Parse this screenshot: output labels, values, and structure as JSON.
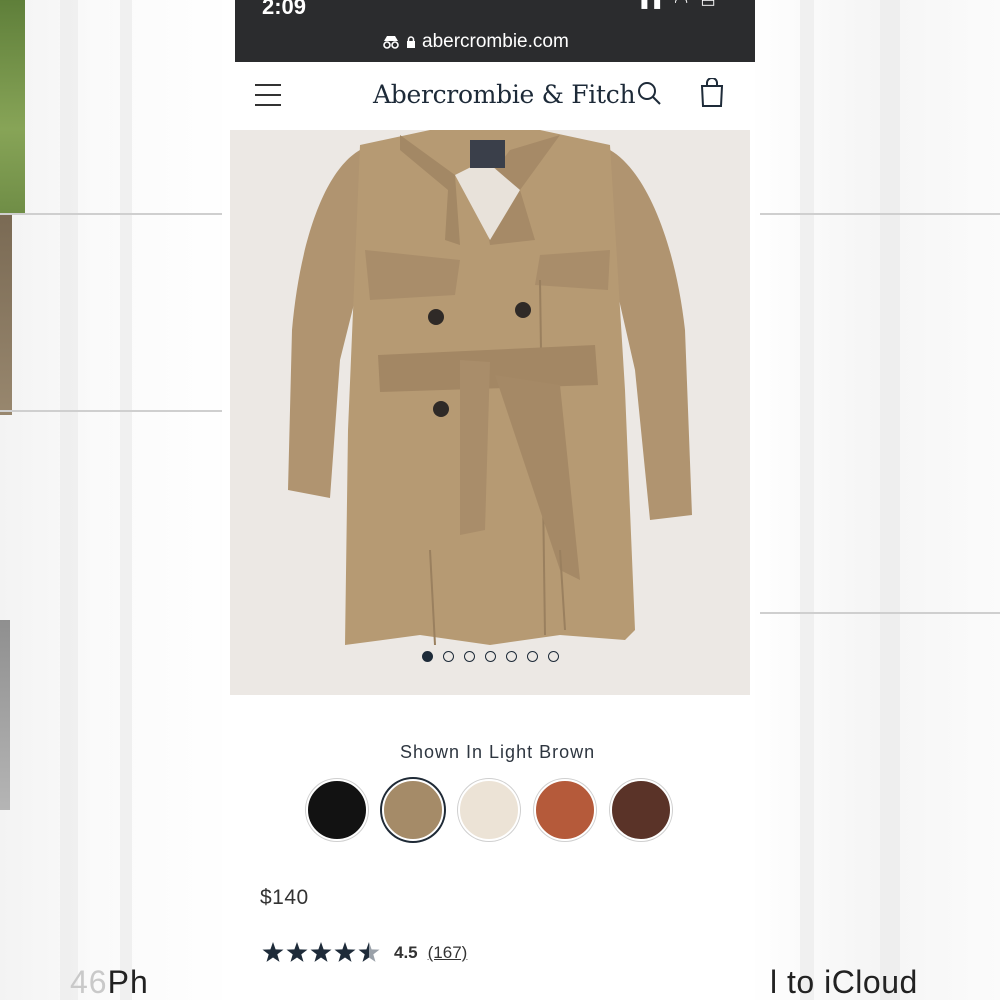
{
  "status_bar": {
    "time": "2:09"
  },
  "browser": {
    "url": "abercrombie.com"
  },
  "header": {
    "logo": "Abercrombie & Fitch"
  },
  "product": {
    "shown_in": "Shown In Light Brown",
    "price": "$140",
    "rating_value": "4.5",
    "rating_stars": 4.5,
    "review_count": "(167)",
    "image_count": 7,
    "active_image_index": 0,
    "swatches": [
      {
        "name": "black",
        "color": "#121212"
      },
      {
        "name": "light-brown",
        "color": "#a58b68"
      },
      {
        "name": "cream",
        "color": "#ece3d6"
      },
      {
        "name": "rust",
        "color": "#b55a3a"
      },
      {
        "name": "dark-brown",
        "color": "#5a3328"
      }
    ],
    "selected_swatch": 1
  },
  "overlay": {
    "left_text_faded": "46",
    "left_text_dark": "Ph",
    "right_text": "l to iCloud"
  },
  "colors": {
    "navy": "#1e2b39",
    "coat": "#b69a73",
    "image_bg": "#ece8e4"
  }
}
